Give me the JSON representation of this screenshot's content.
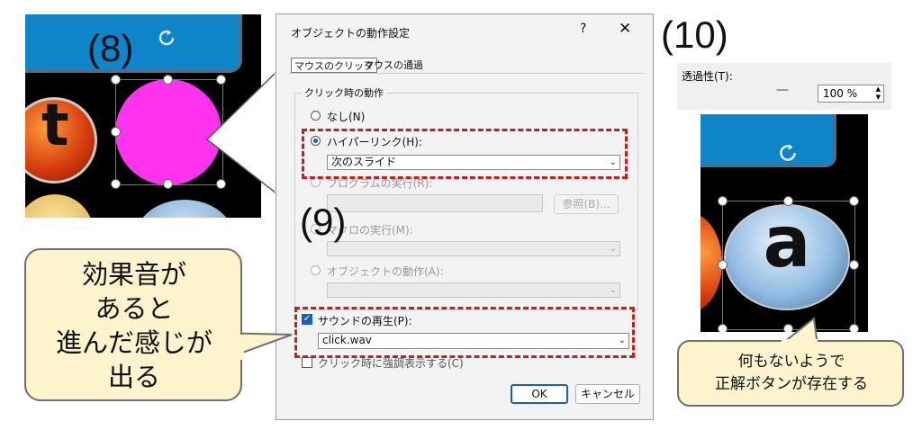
{
  "labels": {
    "step8": "(8)",
    "step9": "(9)",
    "step10": "(10)"
  },
  "left_shot": {
    "left_button_letter": "t"
  },
  "dialog": {
    "title": "オブジェクトの動作設定",
    "help": "?",
    "close": "✕",
    "tabs": [
      {
        "label": "マウスのクリック"
      },
      {
        "label": "マウスの通過"
      }
    ],
    "group_title": "クリック時の動作",
    "options": {
      "none": "なし(N)",
      "hyperlink": "ハイパーリンク(H):",
      "program": "プログラムの実行(R):",
      "macro": "マクロの実行(M):",
      "object_action": "オブジェクトの動作(A):"
    },
    "hyperlink_value": "次のスライド",
    "browse_button": "参照(B)...",
    "sound_label": "サウンドの再生(P):",
    "sound_value": "click.wav",
    "highlight_label": "クリック時に強調表示する(C)",
    "ok": "OK",
    "cancel": "キャンセル"
  },
  "callout_left": {
    "lines": [
      "効果音が",
      "あると",
      "進んだ感じが",
      "出る"
    ]
  },
  "transparency": {
    "label": "透過性(T):",
    "value": "100 %",
    "dash": "—"
  },
  "right_shot": {
    "button_letter": "a"
  },
  "callout_right": {
    "lines": [
      "何もないようで",
      "正解ボタンが存在する"
    ]
  },
  "colors": {
    "accent_red": "#c81e1e",
    "magenta": "#ff33ee",
    "callout_fill": "#fdf3cc",
    "tile_blue": "#0e85c9"
  }
}
